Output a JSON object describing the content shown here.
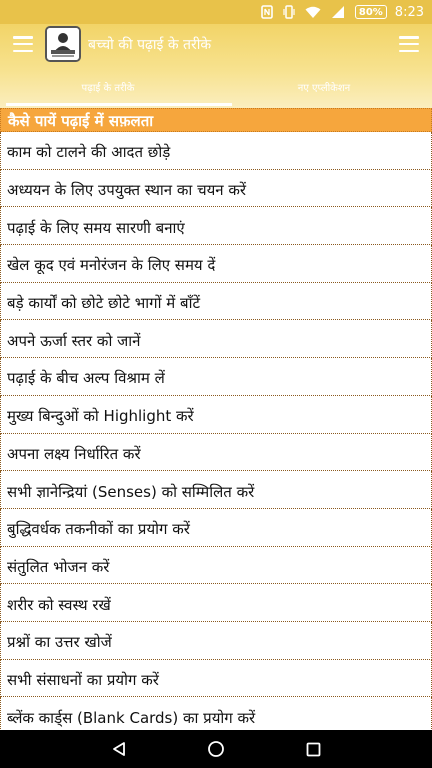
{
  "status_bar": {
    "time": "8:23",
    "battery": "80%",
    "icons": [
      "nfc-icon",
      "vibrate-icon",
      "wifi-icon",
      "signal-icon",
      "battery-icon"
    ]
  },
  "toolbar": {
    "title": "बच्चो की पढ़ाई के तरीके",
    "menu_icon": "hamburger-menu-icon",
    "overflow_icon": "hamburger-menu-icon"
  },
  "tabs": [
    {
      "label": "पढ़ाई के तरीके",
      "selected": true
    },
    {
      "label": "नए एप्लीकेशन",
      "selected": false
    }
  ],
  "section": {
    "title": "कैसे पायें पढ़ाई में सफ़लता"
  },
  "items": [
    "काम को टालने की आदत छोड़े",
    "अध्ययन के लिए उपयुक्त स्थान का चयन करें",
    "पढ़ाई के लिए समय सारणी बनाएं",
    "खेल कूद एवं मनोरंजन के लिए समय दें",
    "बड़े कार्यों को छोटे छोटे भागों में बाँटें",
    "अपने ऊर्जा स्तर को जानें",
    "पढ़ाई के बीच अल्प विश्राम लें",
    "मुख्य बिन्दुओं को Highlight करें",
    "अपना लक्ष्य निर्धारित करें",
    "सभी ज्ञानेन्द्रियां (Senses) को सम्मिलित करें",
    "बुद्धिवर्धक तकनीकों का प्रयोग करें",
    "संतुलित भोजन करें",
    "शरीर को स्वस्थ रखें",
    "प्रश्नों का उत्तर खोजें",
    "सभी संसाधनों का प्रयोग करें",
    "ब्लेंक कार्ड्स (Blank Cards) का प्रयोग करें"
  ],
  "colors": {
    "header": "#f2d467",
    "section_title": "#f6a63d",
    "divider": "#8b5a1f"
  }
}
